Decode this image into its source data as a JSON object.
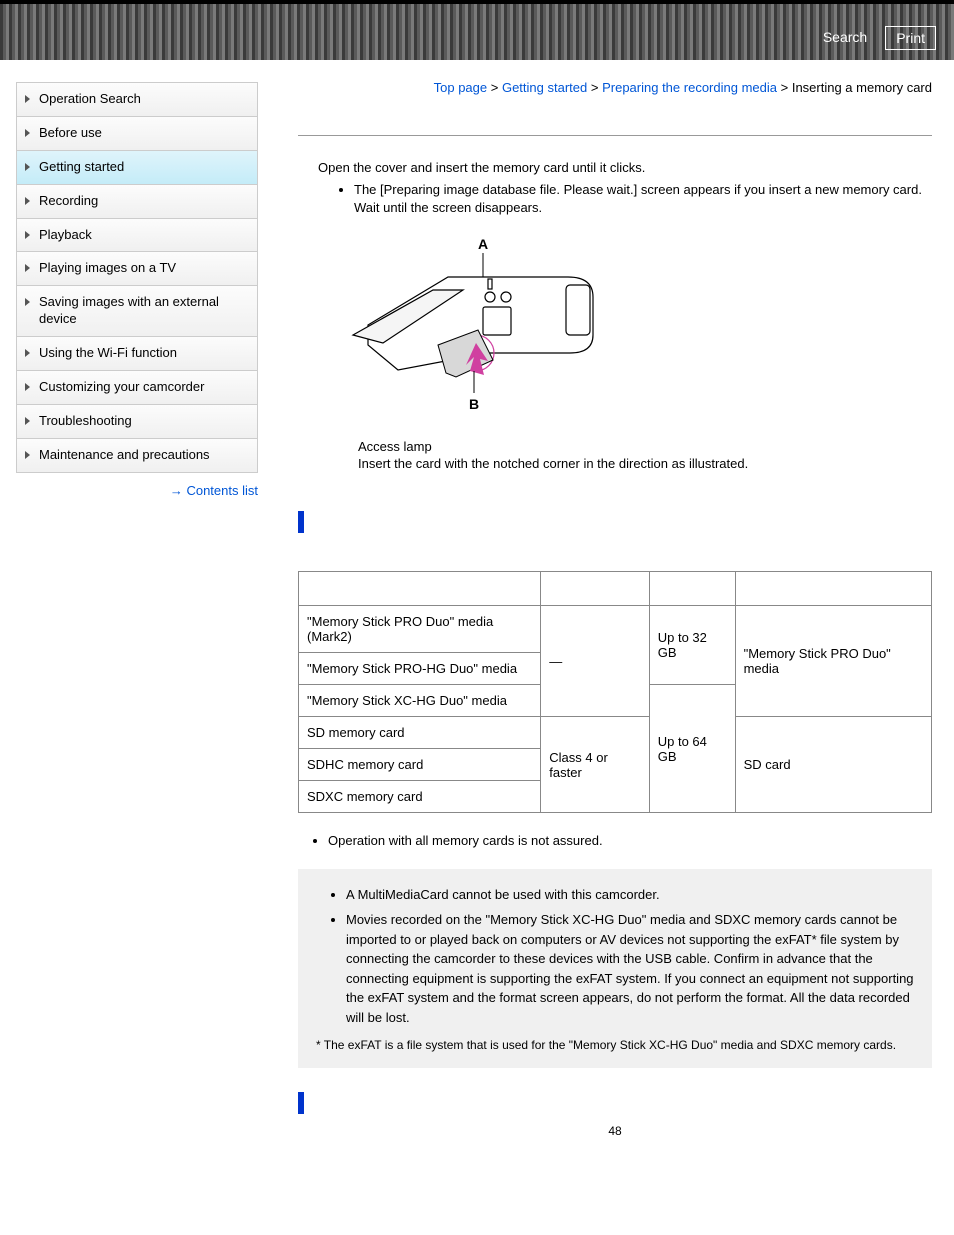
{
  "header": {
    "search_label": "Search",
    "print_label": "Print"
  },
  "sidebar": {
    "items": [
      {
        "label": "Operation Search"
      },
      {
        "label": "Before use"
      },
      {
        "label": "Getting started"
      },
      {
        "label": "Recording"
      },
      {
        "label": "Playback"
      },
      {
        "label": "Playing images on a TV"
      },
      {
        "label": "Saving images with an external device"
      },
      {
        "label": "Using the Wi-Fi function"
      },
      {
        "label": "Customizing your camcorder"
      },
      {
        "label": "Troubleshooting"
      },
      {
        "label": "Maintenance and precautions"
      }
    ],
    "contents_list": "Contents list"
  },
  "breadcrumb": {
    "top": "Top page",
    "b1": "Getting started",
    "b2": "Preparing the recording media",
    "current": "Inserting a memory card",
    "sep": ">"
  },
  "content": {
    "step1": "Open the cover and insert the memory card until it clicks.",
    "bullet1": "The [Preparing image database file. Please wait.] screen appears if you insert a new memory card. Wait until the screen disappears.",
    "label_a": "A",
    "label_b": "B",
    "access_lamp_line": "Access lamp",
    "insert_line": "Insert the card with the notched corner in the direction as illustrated.",
    "table": {
      "h1": "",
      "h2": "",
      "h3": "",
      "h4": "",
      "r1c1": "\"Memory Stick PRO Duo\" media (Mark2)",
      "r2c1": "\"Memory Stick PRO-HG Duo\" media",
      "r3c1": "\"Memory Stick XC-HG Duo\" media",
      "r4c1": "SD memory card",
      "r5c1": "SDHC memory card",
      "r6c1": "SDXC memory card",
      "dash": "—",
      "class4": "Class 4 or faster",
      "cap32": "Up to 32 GB",
      "cap64": "Up to 64 GB",
      "mspd": "\"Memory Stick PRO Duo\" media",
      "sdcard": "SD card"
    },
    "body_bullet1": "Operation with all memory cards is not assured.",
    "note1": "A MultiMediaCard cannot be used with this camcorder.",
    "note2": "Movies recorded on the \"Memory Stick XC-HG Duo\" media and SDXC memory cards cannot be imported to or played back on computers or AV devices not supporting the exFAT* file system by connecting the camcorder to these devices with the USB cable. Confirm in advance that the connecting equipment is supporting the exFAT system. If you connect an equipment not supporting the exFAT system and the format screen appears, do not perform the format. All the data recorded will be lost.",
    "footnote": "* The exFAT is a file system that is used for the \"Memory Stick XC-HG Duo\" media and SDXC memory cards.",
    "page_number": "48"
  }
}
